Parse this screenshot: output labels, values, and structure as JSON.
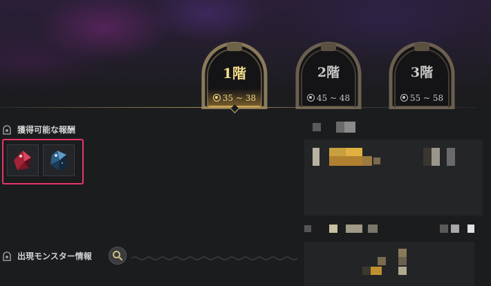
{
  "floors": [
    {
      "label": "1階",
      "range": "35 ~ 38",
      "active": true
    },
    {
      "label": "2階",
      "range": "45 ~ 48",
      "active": false
    },
    {
      "label": "3階",
      "range": "55 ~ 58",
      "active": false
    }
  ],
  "rewards": {
    "title": "獲得可能な報酬",
    "items": [
      {
        "icon": "red-crystal-icon"
      },
      {
        "icon": "blue-crystal-icon"
      }
    ]
  },
  "monsters": {
    "title": "出現モンスター情報"
  },
  "colors": {
    "accent_gold": "#f3dc8c",
    "highlight_border": "#e8366a",
    "background": "#1b1c1e"
  }
}
